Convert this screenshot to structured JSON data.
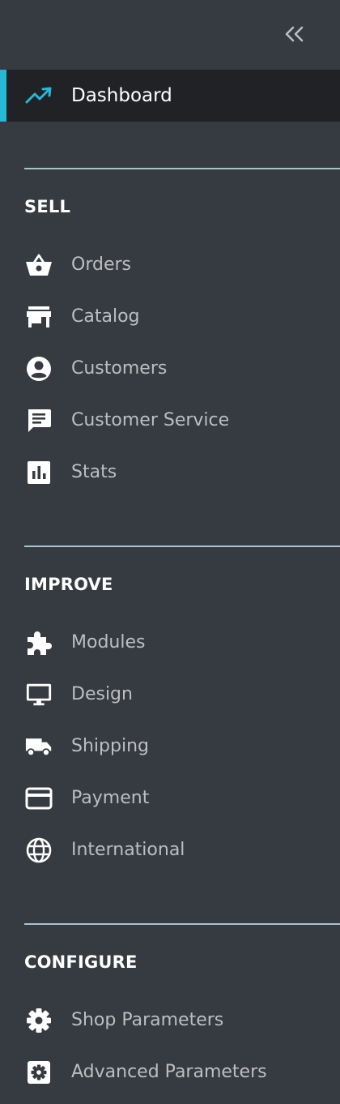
{
  "colors": {
    "sidebar_bg": "#363a41",
    "active_bg": "#202226",
    "accent": "#25b9d7",
    "divider": "#a8c4cf",
    "text": "#bebebe",
    "text_active": "#ffffff"
  },
  "collapse": {
    "label": "<<",
    "icon": "double-chevron-left-icon"
  },
  "dashboard": {
    "label": "Dashboard",
    "icon": "trending-up-icon"
  },
  "sections": {
    "sell": {
      "title": "SELL",
      "items": [
        {
          "label": "Orders",
          "icon": "shopping-basket-icon"
        },
        {
          "label": "Catalog",
          "icon": "store-icon"
        },
        {
          "label": "Customers",
          "icon": "account-circle-icon"
        },
        {
          "label": "Customer Service",
          "icon": "chat-icon"
        },
        {
          "label": "Stats",
          "icon": "bar-chart-icon"
        }
      ]
    },
    "improve": {
      "title": "IMPROVE",
      "items": [
        {
          "label": "Modules",
          "icon": "puzzle-icon"
        },
        {
          "label": "Design",
          "icon": "desktop-icon"
        },
        {
          "label": "Shipping",
          "icon": "truck-icon"
        },
        {
          "label": "Payment",
          "icon": "credit-card-icon"
        },
        {
          "label": "International",
          "icon": "globe-icon"
        }
      ]
    },
    "configure": {
      "title": "CONFIGURE",
      "items": [
        {
          "label": "Shop Parameters",
          "icon": "gear-icon"
        },
        {
          "label": "Advanced Parameters",
          "icon": "settings-applications-icon"
        }
      ]
    }
  }
}
